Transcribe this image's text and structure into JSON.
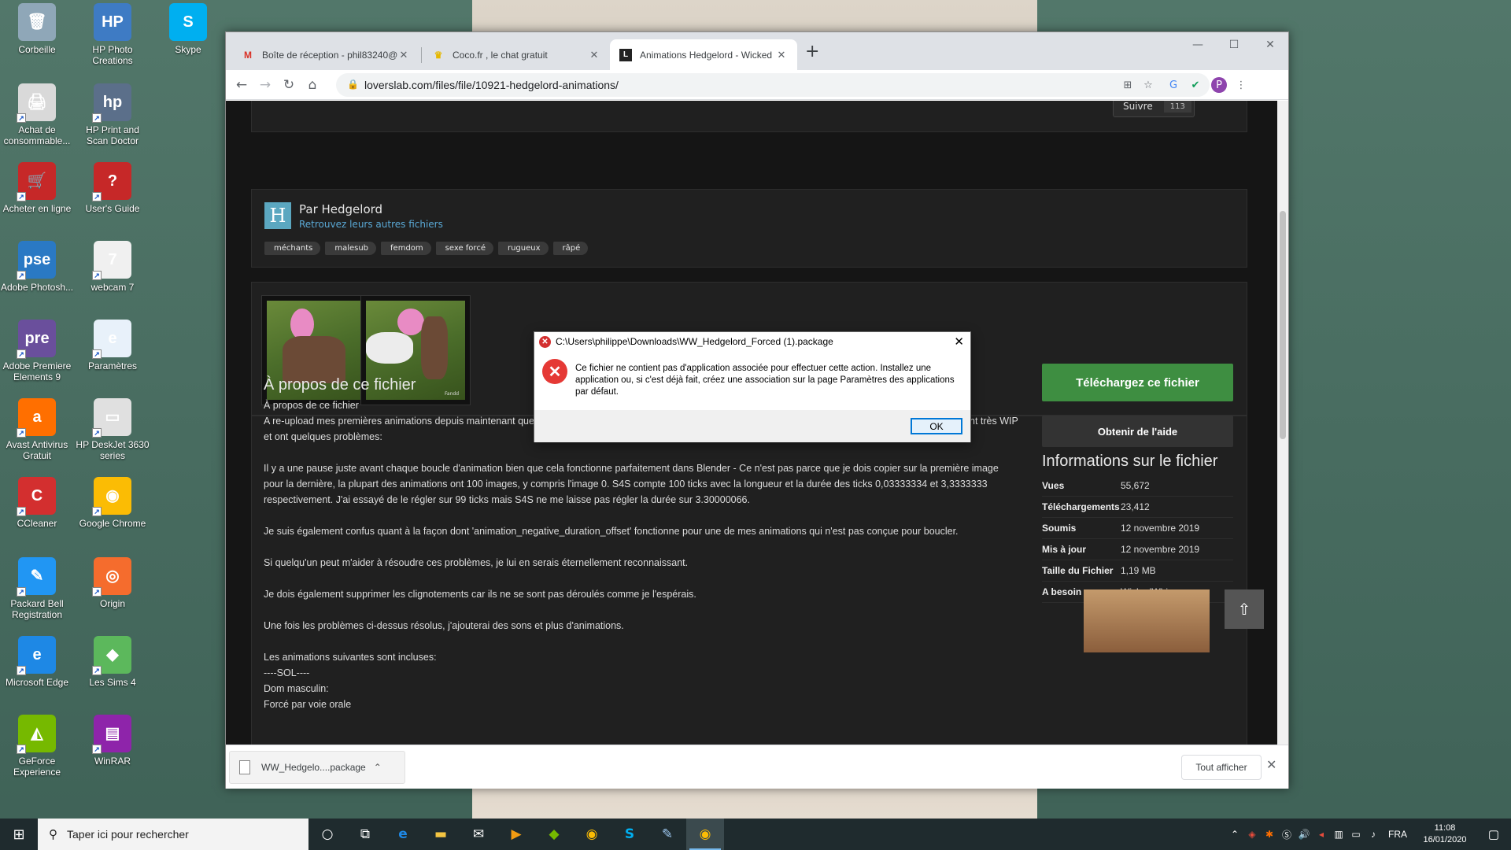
{
  "desktop": {
    "icons": [
      {
        "label": "Corbeille",
        "glyph": "🗑",
        "color": "#8fa7b8"
      },
      {
        "label": "HP Photo Creations",
        "glyph": "HP",
        "color": "#3e7bc4"
      },
      {
        "label": "Skype",
        "glyph": "S",
        "color": "#00aff0"
      },
      {
        "label": "Achat de consommable...",
        "glyph": "🖨",
        "color": "#d9d9d9"
      },
      {
        "label": "HP Print and Scan Doctor",
        "glyph": "hp",
        "color": "#5b6f8a"
      },
      {
        "label": "Acheter en ligne",
        "glyph": "🛒",
        "color": "#c62828"
      },
      {
        "label": "User's Guide",
        "glyph": "?",
        "color": "#c62828"
      },
      {
        "label": "Adobe Photosh...",
        "glyph": "pse",
        "color": "#2a79c4"
      },
      {
        "label": "webcam 7",
        "glyph": "7",
        "color": "#f0f0f0"
      },
      {
        "label": "Adobe Premiere Elements 9",
        "glyph": "pre",
        "color": "#6a4f9c"
      },
      {
        "label": "Paramètres",
        "glyph": "e",
        "color": "#e8f1fa"
      },
      {
        "label": "Avast Antivirus Gratuit",
        "glyph": "a",
        "color": "#ff6f00"
      },
      {
        "label": "HP DeskJet 3630 series",
        "glyph": "▭",
        "color": "#e0e0e0"
      },
      {
        "label": "CCleaner",
        "glyph": "C",
        "color": "#d32f2f"
      },
      {
        "label": "Google Chrome",
        "glyph": "◉",
        "color": "#fbbc04"
      },
      {
        "label": "Packard Bell Registration",
        "glyph": "✎",
        "color": "#2196f3"
      },
      {
        "label": "Origin",
        "glyph": "◎",
        "color": "#f56c2d"
      },
      {
        "label": "Microsoft Edge",
        "glyph": "e",
        "color": "#1e88e5"
      },
      {
        "label": "Les Sims 4",
        "glyph": "◆",
        "color": "#5cb85c"
      },
      {
        "label": "GeForce Experience",
        "glyph": "◭",
        "color": "#76b900"
      },
      {
        "label": "WinRAR",
        "glyph": "▤",
        "color": "#8e24aa"
      }
    ]
  },
  "browser": {
    "tabs": [
      {
        "label": "Boîte de réception - phil83240@",
        "favicon": "M",
        "color": "#d93025"
      },
      {
        "label": "Coco.fr , le chat gratuit",
        "favicon": "♛",
        "color": "#e6b800"
      },
      {
        "label": "Animations Hedgelord - Wicked",
        "favicon": "L",
        "color": "#222222"
      }
    ],
    "url": "loverslab.com/files/file/10921-hedgelord-animations/",
    "window_controls": {
      "minimize": "—",
      "maximize": "☐",
      "close": "✕"
    },
    "profile_initial": "P"
  },
  "page": {
    "follow_label": "Suivre",
    "follow_count": "113",
    "author_initial": "H",
    "author_name": "Par Hedgelord",
    "author_link": "Retrouvez leurs autres fichiers",
    "tags": [
      "méchants",
      "malesub",
      "femdom",
      "sexe forcé",
      "rugueux",
      "râpé"
    ],
    "about_heading": "À propos de ce fichier",
    "about_paragraphs": [
      "À propos de ce fichier",
      "A re-upload mes premières animations depuis maintenant que je suis enfin en mesure de soumettre des fichiers depuis mon nouveau compte. Ce sont actuellement très WIP et ont quelques problèmes:",
      "",
      "Il y a une pause juste avant chaque boucle d'animation bien que cela fonctionne parfaitement dans Blender - Ce n'est pas parce que je dois copier sur la première image pour la dernière, la plupart des animations ont 100 images, y compris l'image 0. S4S compte 100 ticks avec la longueur et la durée des ticks 0,03333334 et 3,3333333 respectivement. J'ai essayé de le régler sur 99 ticks mais S4S ne me laisse pas régler la durée sur 3.30000066.",
      "",
      "Je suis également confus quant à la façon dont 'animation_negative_duration_offset' fonctionne pour une de mes animations qui n'est pas conçue pour boucler.",
      "",
      "Si quelqu'un peut m'aider à résoudre ces problèmes, je lui en serais éternellement reconnaissant.",
      "",
      "Je dois également supprimer les clignotements car ils ne se sont pas déroulés comme je l'espérais.",
      "",
      "Une fois les problèmes ci-dessus résolus, j'ajouterai des sons et plus d'animations.",
      "",
      "Les animations suivantes sont incluses:",
      "----SOL----",
      "Dom masculin:",
      "Forcé par voie orale"
    ],
    "download_button": "Téléchargez ce fichier",
    "help_button": "Obtenir de l'aide",
    "info_heading": "Informations sur le fichier",
    "info_rows": [
      {
        "k": "Vues",
        "v": "55,672"
      },
      {
        "k": "Téléchargements",
        "v": "23,412"
      },
      {
        "k": "Soumis",
        "v": "12 novembre 2019"
      },
      {
        "k": "Mis à jour",
        "v": "12 novembre 2019"
      },
      {
        "k": "Taille du Fichier",
        "v": "1,19 MB"
      },
      {
        "k": "A besoin",
        "v": "WickedWhims"
      }
    ],
    "thumb_caption": "Fandd"
  },
  "download_bar": {
    "file": "WW_Hedgelo....package",
    "show_all": "Tout afficher"
  },
  "dialog": {
    "title": "C:\\Users\\philippe\\Downloads\\WW_Hedgelord_Forced (1).package",
    "message": "Ce fichier ne contient pas d'application associée pour effectuer cette action. Installez une application ou, si c'est déjà fait, créez une association sur la page Paramètres des applications par défaut.",
    "ok": "OK"
  },
  "taskbar": {
    "search_placeholder": "Taper ici pour rechercher",
    "language": "FRA",
    "time": "11:08",
    "date": "16/01/2020"
  }
}
